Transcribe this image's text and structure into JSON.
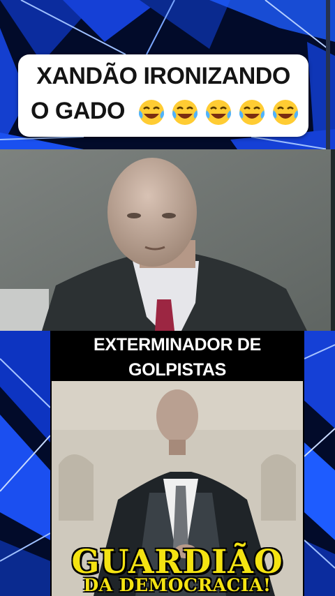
{
  "caption": {
    "line1": "XANDÃO IRONIZANDO",
    "line2": "O GADO",
    "emoji_count": 5,
    "emoji_name": "face-with-tears-of-joy-icon"
  },
  "poster": {
    "title_line1": "EXTERMINADOR DE",
    "title_line2": "GOLPISTAS",
    "slogan_line1": "GUARDIÃO",
    "slogan_line2": "DA DEMOCRACIA!"
  },
  "colors": {
    "background": "#020b2a",
    "shard_blue": "#1e5cff",
    "caption_box": "#ffffff",
    "slogan_yellow": "#f4e312"
  }
}
